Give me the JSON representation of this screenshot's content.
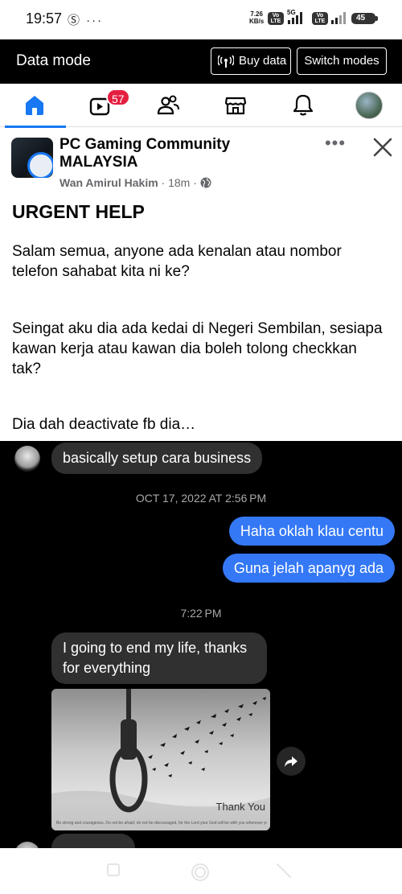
{
  "status_bar": {
    "time": "19:57",
    "left_icons": "Ⓢ ···",
    "net_speed_value": "7.26",
    "net_speed_unit": "KB/s",
    "network_type": "5G",
    "volte_label": "Vo LTE",
    "battery": "45"
  },
  "data_mode_bar": {
    "title": "Data mode",
    "buy_data_label": "Buy data",
    "switch_modes_label": "Switch modes"
  },
  "nav": {
    "video_badge": "57",
    "items": [
      "home-icon",
      "video-icon",
      "friends-icon",
      "marketplace-icon",
      "notifications-icon",
      "profile-avatar"
    ],
    "accent": "#1877f2"
  },
  "post": {
    "group_name": "PC Gaming Community MALAYSIA",
    "author": "Wan Amirul Hakim",
    "time_ago": "18m",
    "separator": "·",
    "title": "URGENT HELP",
    "paragraphs": [
      "Salam semua, anyone ada kenalan atau nombor telefon sahabat kita ni ke?",
      "Seingat aku dia ada kedai di Negeri Sembilan, sesiapa kawan kerja atau kawan dia boleh tolong checkkan tak?",
      "Dia dah deactivate fb dia…"
    ]
  },
  "chat": {
    "messages": [
      {
        "dir": "in",
        "text": "basically setup cara business"
      },
      {
        "dir": "timestamp",
        "text": "OCT 17, 2022 AT 2:56 PM"
      },
      {
        "dir": "out",
        "text": "Haha oklah klau centu"
      },
      {
        "dir": "out",
        "text": "Guna jelah apanyg ada"
      },
      {
        "dir": "timestamp",
        "text": "7:22 PM"
      },
      {
        "dir": "in",
        "text": "I going to end my life, thanks for everything"
      }
    ],
    "image_caption": "Thank You",
    "image_verse": "Be strong and courageous. Do not be afraid; do not be discouraged, for the Lord your God will be with you wherever you go. - Bible, Joshua",
    "outgoing_color": "#3478f6",
    "incoming_color": "#303030"
  }
}
